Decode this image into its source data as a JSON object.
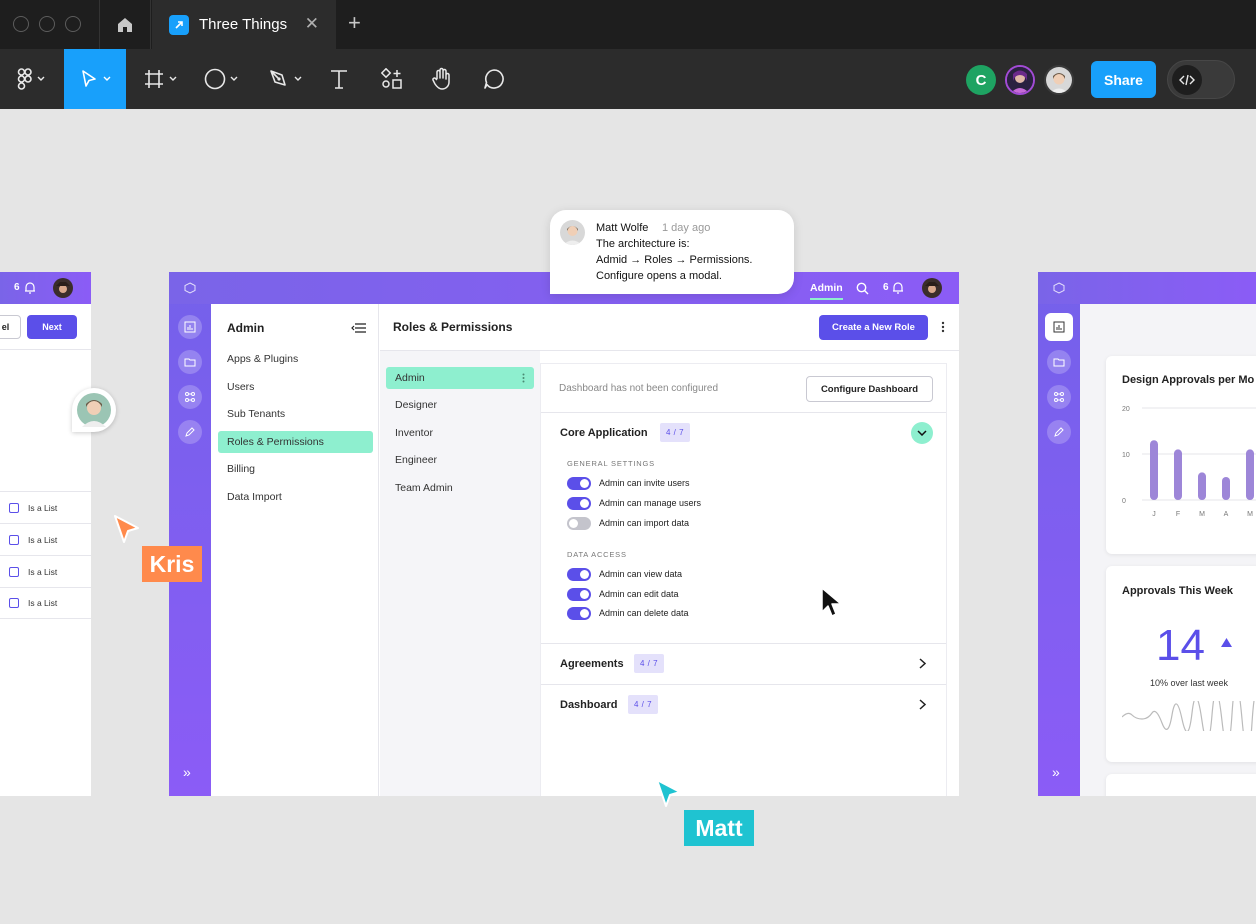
{
  "app": {
    "tab_title": "Three Things",
    "share_label": "Share",
    "collaborator_initial": "C"
  },
  "comment": {
    "author": "Matt Wolfe",
    "time": "1 day ago",
    "lines": [
      "The architecture is:",
      "Admid → Roles → Permissions.",
      "Configure opens a modal."
    ]
  },
  "cursors": {
    "kris": {
      "label": "Kris",
      "color": "#ff8a4c"
    },
    "matt": {
      "label": "Matt",
      "color": "#1fc3d1"
    }
  },
  "left_frame": {
    "notification_count": "6",
    "cancel_label": "el",
    "next_label": "Next",
    "list_items": [
      "Is a List",
      "Is a List",
      "Is a List",
      "Is a List"
    ]
  },
  "main_frame": {
    "top_tab": "Admin",
    "notification_count": "6",
    "nav_title": "Admin",
    "nav_items": [
      "Apps & Plugins",
      "Users",
      "Sub Tenants",
      "Roles & Permissions",
      "Billing",
      "Data Import"
    ],
    "page_title": "Roles & Permissions",
    "create_button": "Create a New Role",
    "roles": [
      "Admin",
      "Designer",
      "Inventor",
      "Engineer",
      "Team Admin"
    ],
    "dashboard_notice": "Dashboard has not been configured",
    "configure_button": "Configure Dashboard",
    "core_app": {
      "title": "Core Application",
      "badge": "4 / 7",
      "general_label": "GENERAL SETTINGS",
      "general": [
        {
          "label": "Admin can invite users",
          "on": true
        },
        {
          "label": "Admin can manage users",
          "on": true
        },
        {
          "label": "Admin can import data",
          "on": false
        }
      ],
      "data_label": "DATA ACCESS",
      "data": [
        {
          "label": "Admin can view data",
          "on": true
        },
        {
          "label": "Admin can edit data",
          "on": true
        },
        {
          "label": "Admin can delete data",
          "on": true
        }
      ]
    },
    "agreements": {
      "title": "Agreements",
      "badge": "4 / 7"
    },
    "dashboard": {
      "title": "Dashboard",
      "badge": "4 / 7"
    }
  },
  "right_frame": {
    "approvals_chart_title": "Design Approvals per Mo",
    "approvals_week_title": "Approvals This Week",
    "approvals_count": "14",
    "approvals_change": "10% over last week",
    "chart_data": {
      "type": "bar",
      "title": "Design Approvals per Mo",
      "categories": [
        "J",
        "F",
        "M",
        "A",
        "M"
      ],
      "values": [
        13,
        11,
        6,
        5,
        11
      ],
      "ylim": [
        0,
        20
      ],
      "yticks": [
        "20",
        "10",
        "0"
      ]
    }
  },
  "colors": {
    "accent": "#18a0fb",
    "purple": "#5b4fe9",
    "mint": "#8eefcf"
  }
}
